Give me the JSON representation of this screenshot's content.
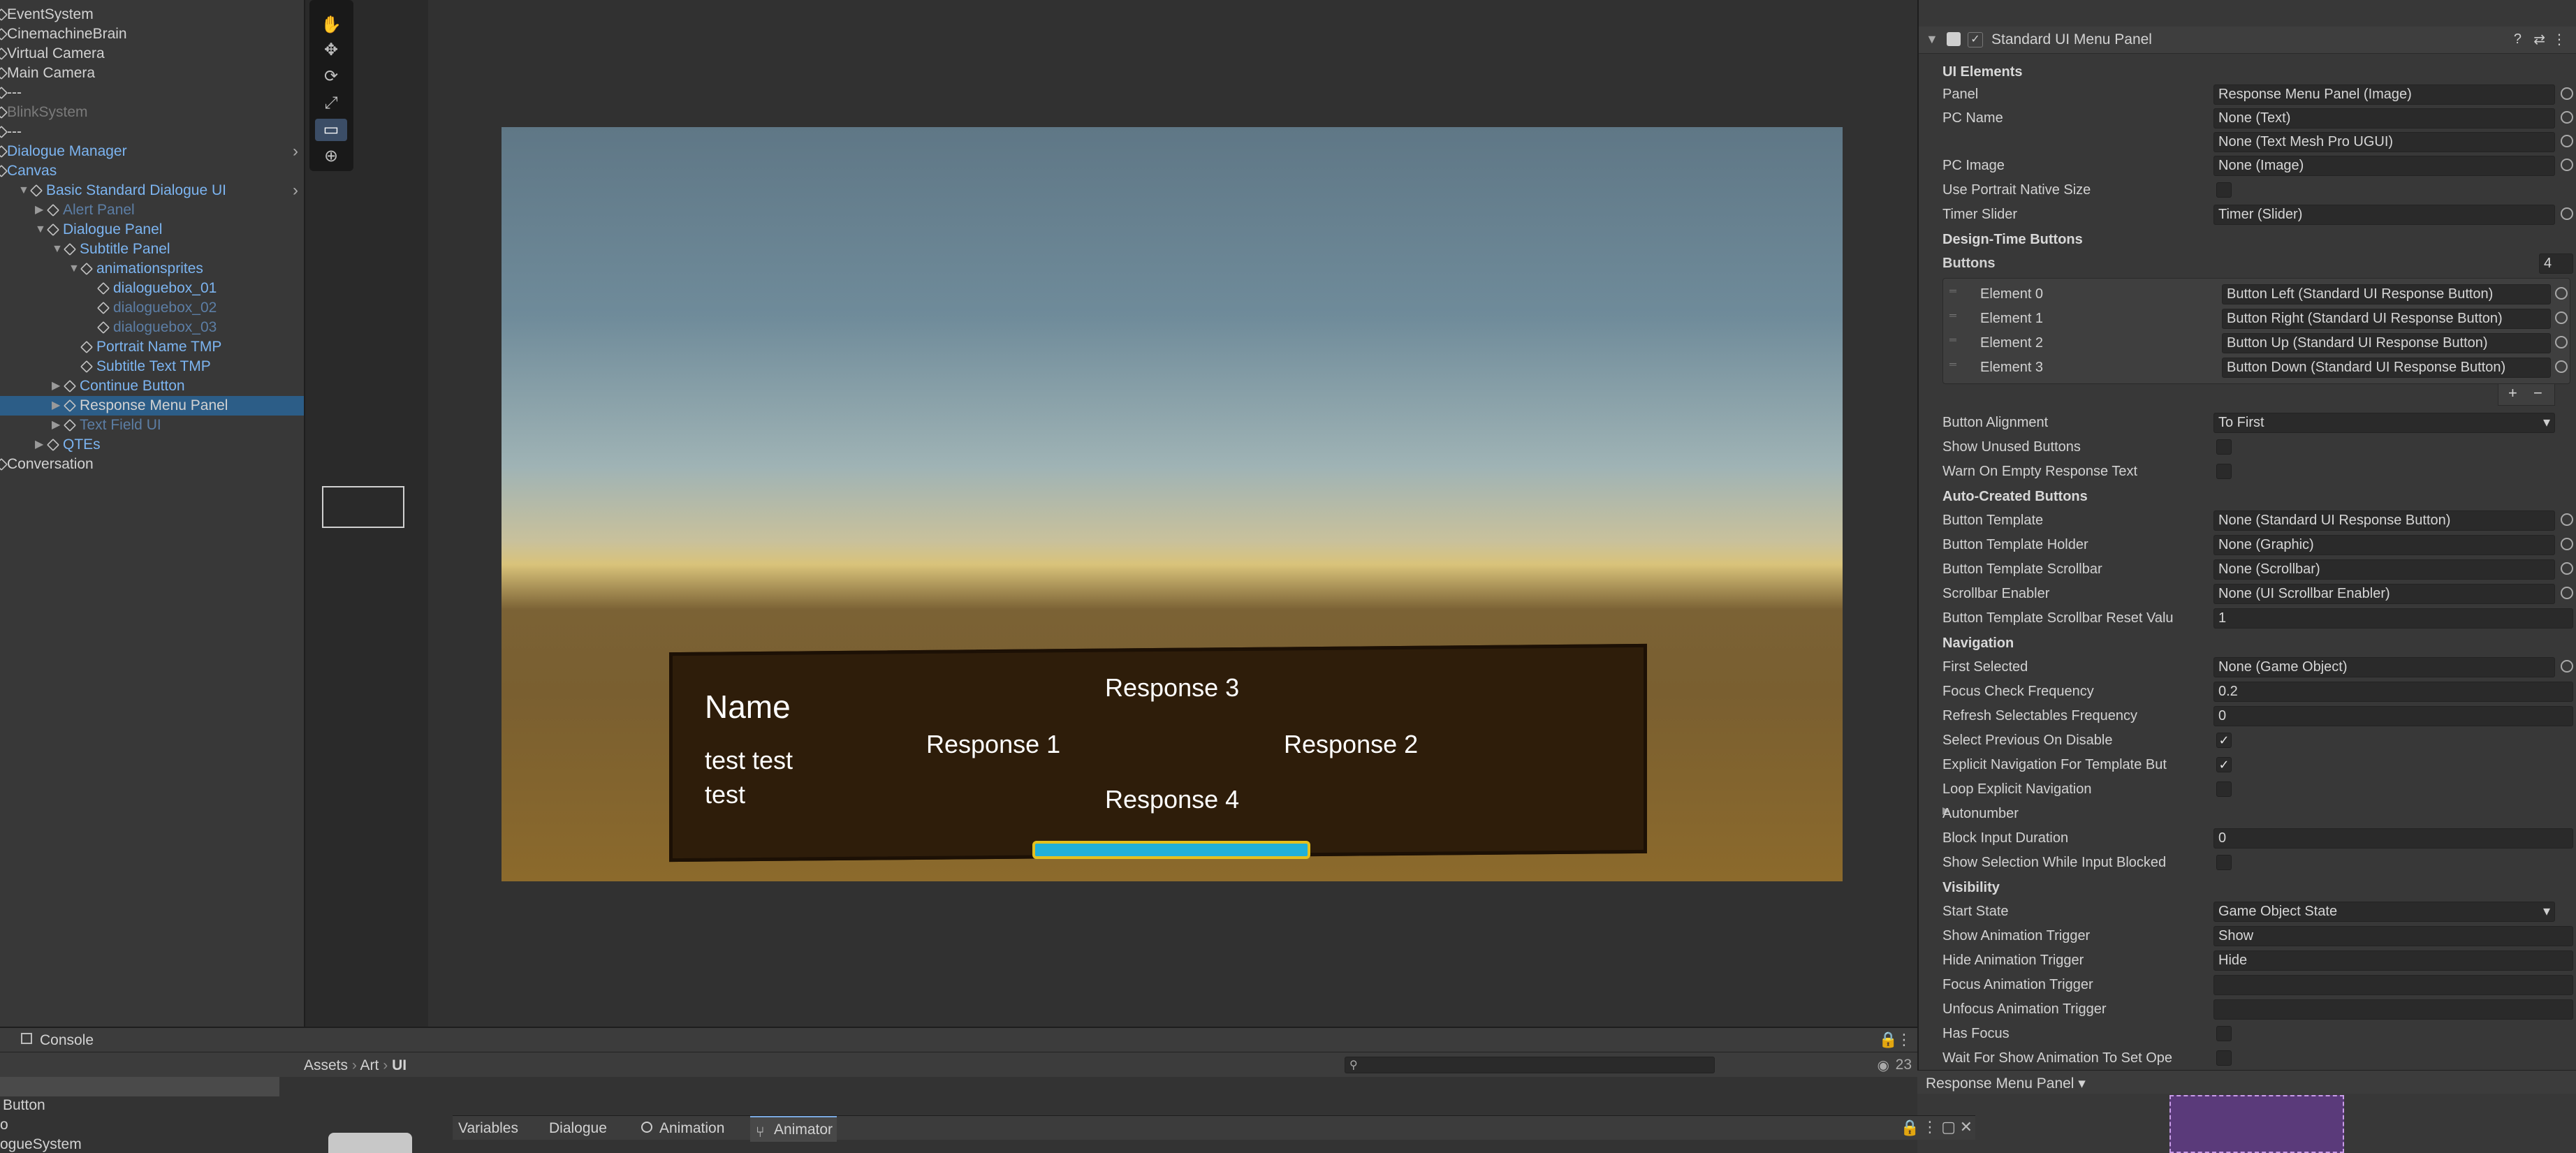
{
  "hierarchy": {
    "items": [
      {
        "label": "EventSystem",
        "color": "white"
      },
      {
        "label": "CinemachineBrain",
        "color": "white"
      },
      {
        "label": "Virtual Camera",
        "color": "white"
      },
      {
        "label": "Main Camera",
        "color": "white"
      },
      {
        "label": "---",
        "color": "white"
      },
      {
        "label": "BlinkSystem",
        "color": "gray"
      },
      {
        "label": "---",
        "color": "white"
      },
      {
        "label": "Dialogue Manager",
        "color": "blue"
      },
      {
        "label": "Canvas",
        "color": "blue"
      },
      {
        "label": "Basic Standard Dialogue UI",
        "color": "blue"
      },
      {
        "label": "Alert Panel",
        "color": "dim"
      },
      {
        "label": "Dialogue Panel",
        "color": "blue"
      },
      {
        "label": "Subtitle Panel",
        "color": "blue"
      },
      {
        "label": "animationsprites",
        "color": "blue"
      },
      {
        "label": "dialoguebox_01",
        "color": "blue"
      },
      {
        "label": "dialoguebox_02",
        "color": "dim"
      },
      {
        "label": "dialoguebox_03",
        "color": "dim"
      },
      {
        "label": "Portrait Name TMP",
        "color": "blue"
      },
      {
        "label": "Subtitle Text TMP",
        "color": "blue"
      },
      {
        "label": "Continue Button",
        "color": "blue"
      },
      {
        "label": "Response Menu Panel",
        "color": "white"
      },
      {
        "label": "Text Field UI",
        "color": "dim"
      },
      {
        "label": "QTEs",
        "color": "blue"
      },
      {
        "label": "Conversation",
        "color": "white"
      }
    ]
  },
  "game": {
    "name": "Name",
    "subtitle_line1": "test test",
    "subtitle_line2": "test",
    "response1": "Response 1",
    "response2": "Response 2",
    "response3": "Response 3",
    "response4": "Response 4"
  },
  "inspector": {
    "component_title": "Standard UI Menu Panel",
    "ui_elements": "UI Elements",
    "panel_label": "Panel",
    "panel_value": "Response Menu Panel (Image)",
    "pc_name_label": "PC Name",
    "pc_name_value1": "None (Text)",
    "pc_name_value2": "None (Text Mesh Pro UGUI)",
    "pc_image_label": "PC Image",
    "pc_image_value": "None (Image)",
    "portrait_label": "Use Portrait Native Size",
    "timer_label": "Timer Slider",
    "timer_value": "Timer (Slider)",
    "design_time": "Design-Time Buttons",
    "buttons_label": "Buttons",
    "buttons_count": "4",
    "elements": [
      {
        "label": "Element 0",
        "value": "Button Left (Standard UI Response Button)"
      },
      {
        "label": "Element 1",
        "value": "Button Right (Standard UI Response Button)"
      },
      {
        "label": "Element 2",
        "value": "Button Up (Standard UI Response Button)"
      },
      {
        "label": "Element 3",
        "value": "Button Down (Standard UI Response Button)"
      }
    ],
    "add": "+",
    "remove": "−",
    "alignment_label": "Button Alignment",
    "alignment_value": "To First",
    "show_unused": "Show Unused Buttons",
    "warn_empty": "Warn On Empty Response Text",
    "auto_created": "Auto-Created Buttons",
    "template_label": "Button Template",
    "template_value": "None (Standard UI Response Button)",
    "holder_label": "Button Template Holder",
    "holder_value": "None (Graphic)",
    "scrollbar_label": "Button Template Scrollbar",
    "scrollbar_value": "None (Scrollbar)",
    "enabler_label": "Scrollbar Enabler",
    "enabler_value": "None (UI Scrollbar Enabler)",
    "reset_label": "Button Template Scrollbar Reset Valu",
    "reset_value": "1",
    "navigation": "Navigation",
    "first_selected_label": "First Selected",
    "first_selected_value": "None (Game Object)",
    "focus_freq_label": "Focus Check Frequency",
    "focus_freq_value": "0.2",
    "refresh_label": "Refresh Selectables Frequency",
    "refresh_value": "0",
    "select_prev_label": "Select Previous On Disable",
    "explicit_label": "Explicit Navigation For Template But",
    "loop_label": "Loop Explicit Navigation",
    "autonumber": "Autonumber",
    "block_label": "Block Input Duration",
    "block_value": "0",
    "show_sel_label": "Show Selection While Input Blocked",
    "visibility": "Visibility",
    "start_state_label": "Start State",
    "start_state_value": "Game Object State",
    "show_anim_label": "Show Animation Trigger",
    "show_anim_value": "Show",
    "hide_anim_label": "Hide Animation Trigger",
    "hide_anim_value": "Hide",
    "focus_anim_label": "Focus Animation Trigger",
    "unfocus_anim_label": "Unfocus Animation Trigger",
    "has_focus_label": "Has Focus",
    "wait_label": "Wait For Show Animation To Set Ope",
    "footer_label": "Response Menu Panel ▾"
  },
  "bottom": {
    "console": "Console",
    "count": "23",
    "breadcrumb_assets": "Assets",
    "breadcrumb_art": "Art",
    "breadcrumb_ui": "UI",
    "left_items": [
      "Button",
      "o",
      "ogueSystem"
    ],
    "tabs": [
      "Variables",
      "Dialogue",
      "Animation",
      "Animator"
    ]
  }
}
